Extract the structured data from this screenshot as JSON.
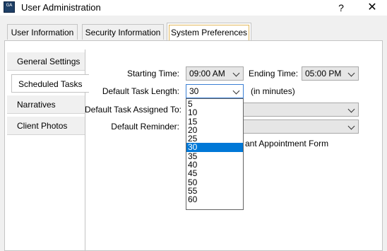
{
  "window": {
    "title": "User Administration",
    "icon_text": "GA",
    "help_label": "?",
    "close_label": "✕"
  },
  "tabs": [
    {
      "label": "User Information",
      "active": false
    },
    {
      "label": "Security Information",
      "active": false
    },
    {
      "label": "System Preferences",
      "active": true
    }
  ],
  "sidebar": {
    "items": [
      {
        "label": "General Settings",
        "active": false
      },
      {
        "label": "Scheduled Tasks",
        "active": true
      },
      {
        "label": "Narratives",
        "active": false
      },
      {
        "label": "Client Photos",
        "active": false
      }
    ]
  },
  "form": {
    "starting_time_label": "Starting Time:",
    "starting_time_value": "09:00 AM",
    "ending_time_label": "Ending Time:",
    "ending_time_value": "05:00 PM",
    "default_task_length_label": "Default Task Length:",
    "default_task_length_value": "30",
    "minutes_note": "(in minutes)",
    "assigned_to_label": "Default Task Assigned To:",
    "assigned_to_value": "",
    "reminder_label": "Default Reminder:",
    "reminder_value": "",
    "partial_checkbox_text": "ant Appointment Form"
  },
  "task_length_options": [
    "5",
    "10",
    "15",
    "20",
    "25",
    "30",
    "35",
    "40",
    "45",
    "50",
    "55",
    "60"
  ],
  "task_length_selected": "30",
  "colors": {
    "selection": "#0078d7",
    "tab_highlight": "#e1b65b",
    "focus_border": "#3b7fd4"
  }
}
